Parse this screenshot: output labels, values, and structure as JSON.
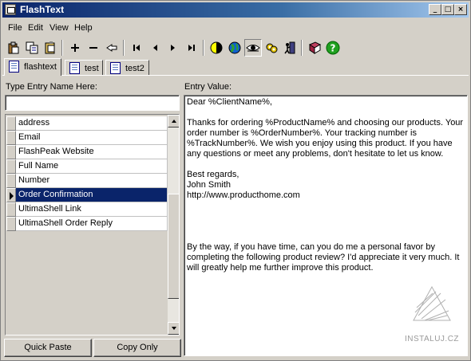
{
  "window": {
    "title": "FlashText"
  },
  "menu": [
    "File",
    "Edit",
    "View",
    "Help"
  ],
  "toolbar": {
    "icons": [
      "paste-icon",
      "copy-icon",
      "paste-special-icon",
      "add-icon",
      "remove-icon",
      "rename-icon",
      "first-icon",
      "previous-icon",
      "next-icon",
      "last-icon",
      "contrast-icon",
      "globe-icon",
      "eye-icon",
      "tools-icon",
      "exit-icon",
      "book-icon",
      "help-icon"
    ]
  },
  "tabs": [
    {
      "label": "flashtext",
      "active": true
    },
    {
      "label": "test",
      "active": false
    },
    {
      "label": "test2",
      "active": false
    }
  ],
  "left_panel": {
    "name_label": "Type Entry Name Here:",
    "name_value": "",
    "entries": [
      "address",
      "Email",
      "FlashPeak Website",
      "Full Name",
      "Number",
      "Order Confirmation",
      "UltimaShell Link",
      "UltimaShell Order Reply"
    ],
    "selected_index": 5,
    "quick_paste_label": "Quick Paste",
    "copy_only_label": "Copy Only"
  },
  "right_panel": {
    "value_label": "Entry Value:",
    "value_text": "Dear %ClientName%,\n\nThanks for ordering %ProductName% and choosing our products. Your order number is %OrderNumber%. Your tracking number is %TrackNumber%. We wish you enjoy using this product. If you have any questions or meet any problems, don't hesitate to let us know.\n\nBest regards,\nJohn Smith\nhttp://www.producthome.com\n\n\n\n\nBy the way, if you have time, can you do me a personal favor by completing the following product review? I'd appreciate it very much. It will greatly help me further improve this product."
  },
  "watermark": {
    "text": "INSTALUJ.CZ"
  }
}
